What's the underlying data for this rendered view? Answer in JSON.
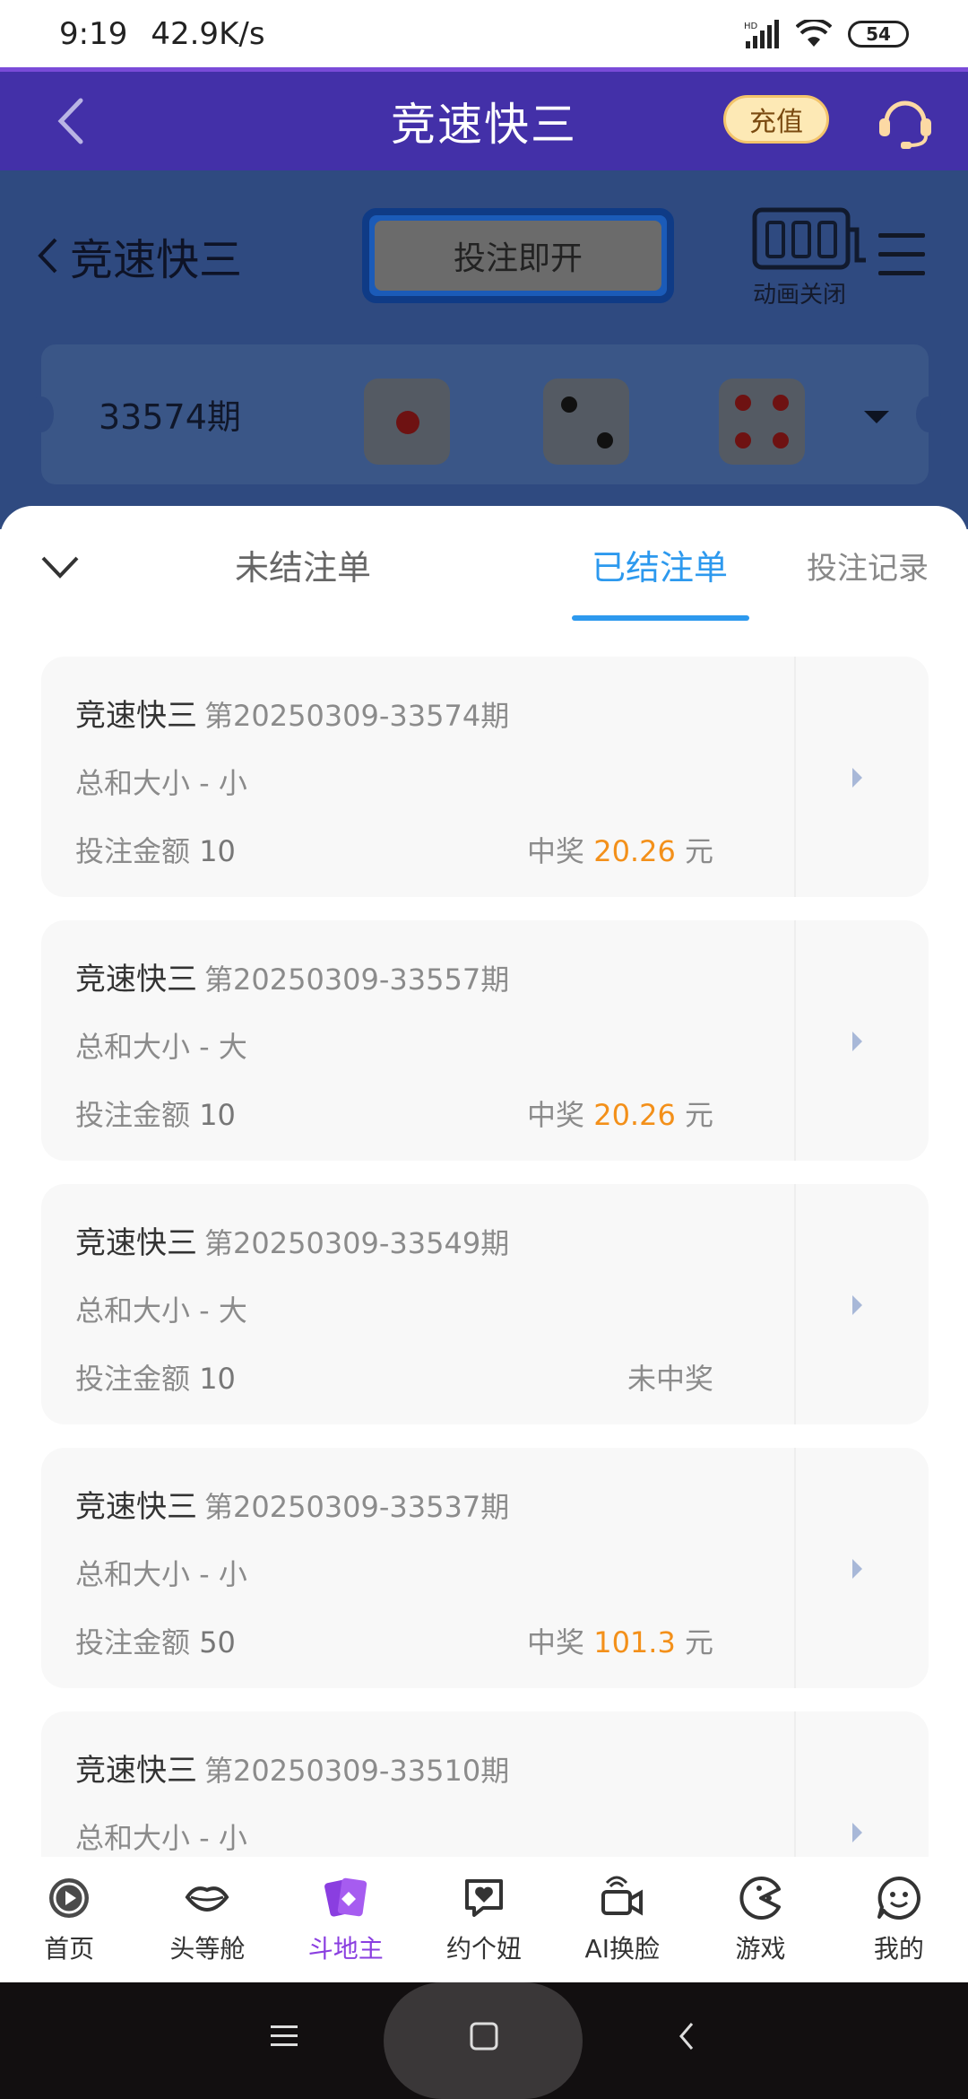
{
  "status_bar": {
    "time": "9:19",
    "speed": "42.9K/s",
    "battery": "54"
  },
  "header": {
    "title": "竞速快三",
    "recharge": "充值"
  },
  "game": {
    "back_title": "竞速快三",
    "bet_button": "投注即开",
    "animation_label": "动画关闭",
    "period": "33574期",
    "dice": [
      1,
      2,
      4
    ]
  },
  "tabs": {
    "unsettled": "未结注单",
    "settled": "已结注单",
    "records": "投注记录"
  },
  "orders": [
    {
      "game": "竞速快三",
      "period": "第20250309-33574期",
      "play": "总和大小 - 小",
      "amount_label": "投注金额",
      "amount": "10",
      "result_prefix": "中奖",
      "win": "20.26",
      "unit": "元",
      "lost": ""
    },
    {
      "game": "竞速快三",
      "period": "第20250309-33557期",
      "play": "总和大小 - 大",
      "amount_label": "投注金额",
      "amount": "10",
      "result_prefix": "中奖",
      "win": "20.26",
      "unit": "元",
      "lost": ""
    },
    {
      "game": "竞速快三",
      "period": "第20250309-33549期",
      "play": "总和大小 - 大",
      "amount_label": "投注金额",
      "amount": "10",
      "result_prefix": "",
      "win": "",
      "unit": "",
      "lost": "未中奖"
    },
    {
      "game": "竞速快三",
      "period": "第20250309-33537期",
      "play": "总和大小 - 小",
      "amount_label": "投注金额",
      "amount": "50",
      "result_prefix": "中奖",
      "win": "101.3",
      "unit": "元",
      "lost": ""
    },
    {
      "game": "竞速快三",
      "period": "第20250309-33510期",
      "play": "总和大小 - 小",
      "amount_label": "",
      "amount": "",
      "result_prefix": "",
      "win": "",
      "unit": "",
      "lost": ""
    }
  ],
  "bottom_nav": [
    {
      "label": "首页",
      "icon": "play-circle-icon"
    },
    {
      "label": "头等舱",
      "icon": "lips-icon"
    },
    {
      "label": "斗地主",
      "icon": "cards-icon"
    },
    {
      "label": "约个妞",
      "icon": "heart-chat-icon"
    },
    {
      "label": "AI换脸",
      "icon": "camera-icon"
    },
    {
      "label": "游戏",
      "icon": "pacman-icon"
    },
    {
      "label": "我的",
      "icon": "smile-chat-icon"
    }
  ],
  "colors": {
    "header": "#4330a8",
    "accent_tab": "#2d99ee",
    "win": "#f3901a",
    "nav_active": "#8a3ee0"
  }
}
